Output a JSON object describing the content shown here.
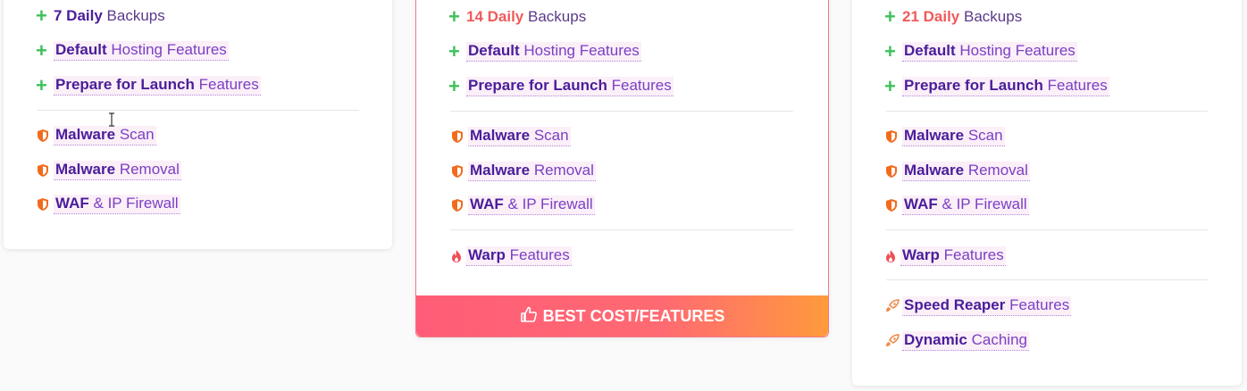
{
  "colors": {
    "accent_green": "#3ec15a",
    "brand_purple": "#4a1d9a",
    "hot_red": "#f05a5a",
    "shield_orange": "#f26b1d",
    "cta_gradient_start": "#ff5c78",
    "cta_gradient_end": "#ff9a3c"
  },
  "card1": {
    "backups": {
      "bold": "7 Daily",
      "rest": "Backups"
    },
    "default_hosting": {
      "bold": "Default",
      "rest": "Hosting Features"
    },
    "prepare_launch": {
      "bold": "Prepare for Launch",
      "rest": "Features"
    },
    "malware_scan": {
      "bold": "Malware",
      "rest": "Scan"
    },
    "malware_removal": {
      "bold": "Malware",
      "rest": "Removal"
    },
    "waf": {
      "bold": "WAF",
      "rest": "& IP Firewall"
    }
  },
  "card2": {
    "backups": {
      "bold": "14 Daily",
      "rest": "Backups"
    },
    "default_hosting": {
      "bold": "Default",
      "rest": "Hosting Features"
    },
    "prepare_launch": {
      "bold": "Prepare for Launch",
      "rest": "Features"
    },
    "malware_scan": {
      "bold": "Malware",
      "rest": "Scan"
    },
    "malware_removal": {
      "bold": "Malware",
      "rest": "Removal"
    },
    "waf": {
      "bold": "WAF",
      "rest": "& IP Firewall"
    },
    "warp": {
      "bold": "Warp",
      "rest": "Features"
    },
    "cta_label": "BEST COST/FEATURES"
  },
  "card3": {
    "backups": {
      "bold": "21 Daily",
      "rest": "Backups"
    },
    "default_hosting": {
      "bold": "Default",
      "rest": "Hosting Features"
    },
    "prepare_launch": {
      "bold": "Prepare for Launch",
      "rest": "Features"
    },
    "malware_scan": {
      "bold": "Malware",
      "rest": "Scan"
    },
    "malware_removal": {
      "bold": "Malware",
      "rest": "Removal"
    },
    "waf": {
      "bold": "WAF",
      "rest": "& IP Firewall"
    },
    "warp": {
      "bold": "Warp",
      "rest": "Features"
    },
    "speed_reaper": {
      "bold": "Speed Reaper",
      "rest": "Features"
    },
    "dynamic_caching": {
      "bold": "Dynamic",
      "rest": "Caching"
    }
  },
  "icons": [
    "plus-icon",
    "shield-icon",
    "flame-icon",
    "rocket-icon",
    "thumbs-up-icon",
    "text-cursor-icon"
  ]
}
